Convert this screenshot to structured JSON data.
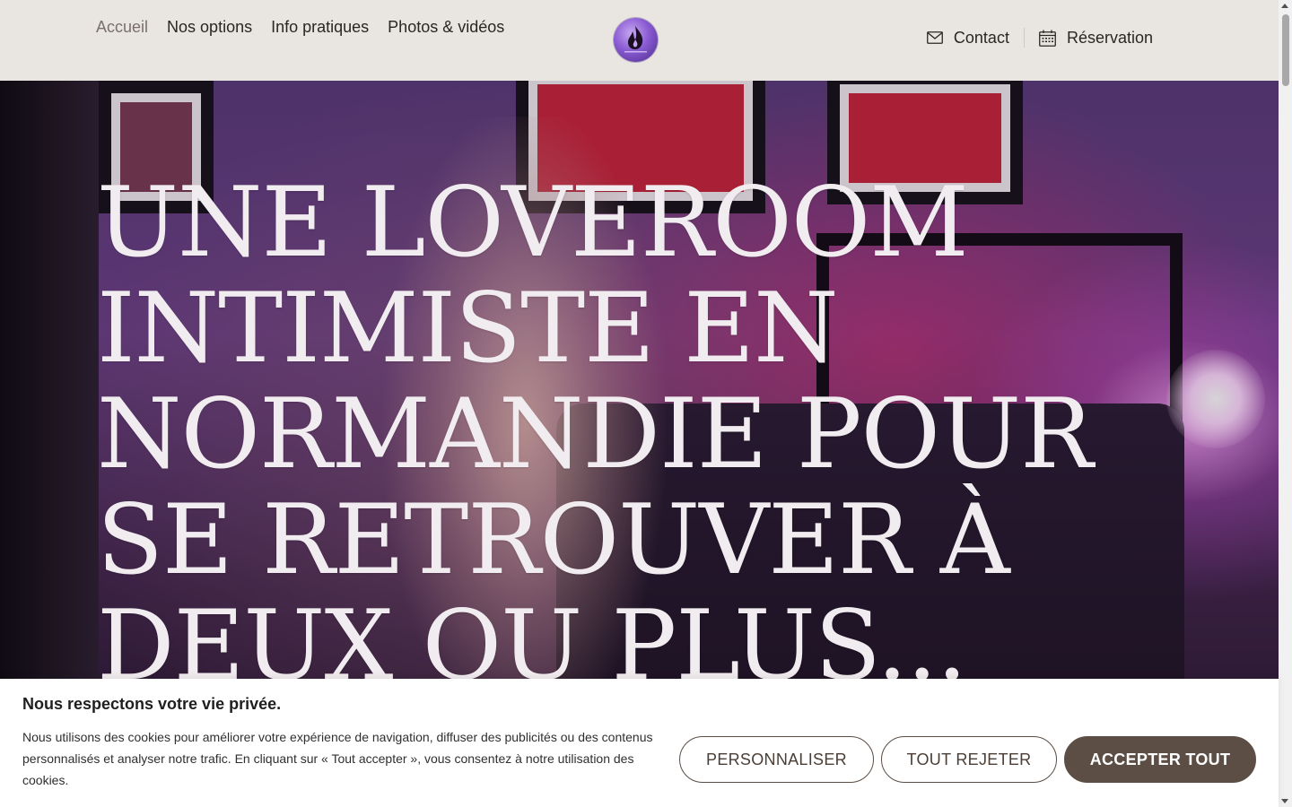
{
  "nav": {
    "left": [
      "Accueil",
      "Nos options",
      "Info pratiques",
      "Photos & vidéos"
    ],
    "right": [
      {
        "label": "Contact",
        "icon": "mail-icon"
      },
      {
        "label": "Réservation",
        "icon": "calendar-icon"
      }
    ]
  },
  "hero": {
    "title": "Une loveroom intimiste en Normandie pour se retrouver à deux ou plus..."
  },
  "cookie": {
    "title": "Nous respectons votre vie privée.",
    "text": "Nous utilisons des cookies pour améliorer votre expérience de navigation, diffuser des publicités ou des contenus personnalisés et analyser notre trafic. En cliquant sur « Tout accepter », vous consentez à notre utilisation des cookies.",
    "buttons": {
      "customize": "PERSONNALISER",
      "reject": "TOUT REJETER",
      "accept": "ACCEPTER TOUT"
    }
  },
  "colors": {
    "header_bg": "#e9e6e2",
    "accent_button": "#5c4e44",
    "logo_purple": "#8a5bd3"
  }
}
